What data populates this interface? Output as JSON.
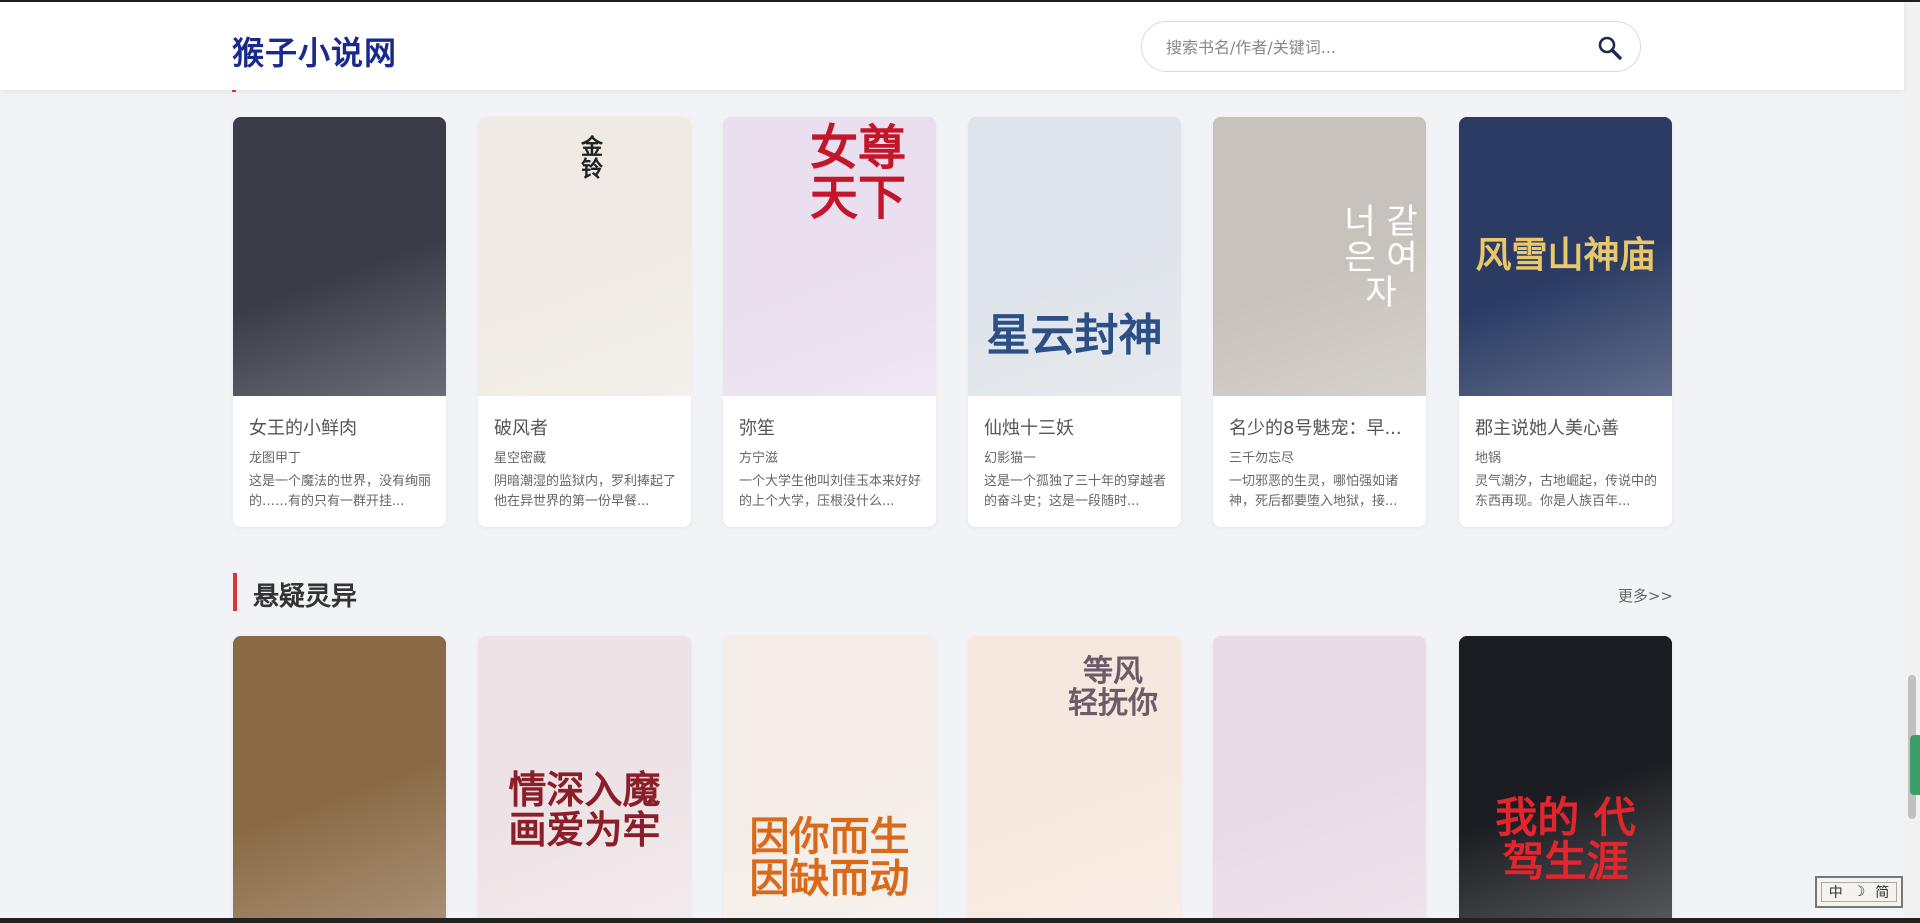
{
  "site": {
    "logo": "猴子小说网"
  },
  "search": {
    "placeholder": "搜索书名/作者/关键词..."
  },
  "section_top": {
    "books": [
      {
        "title": "女王的小鲜肉",
        "author": "龙图甲丁",
        "desc": "这是一个魔法的世界，没有绚丽的……有的只有一群开挂...",
        "cover_text": "",
        "cover_bg": "#3a3d48"
      },
      {
        "title": "破风者",
        "author": "星空密藏",
        "desc": "阴暗潮湿的监狱内，罗利捧起了他在异世界的第一份早餐...",
        "cover_text": "金铃",
        "cover_bg": "#efeae3"
      },
      {
        "title": "弥笙",
        "author": "方宁滋",
        "desc": "一个大学生他叫刘佳玉本来好好的上个大学，压根没什么...",
        "cover_text": "女尊天下",
        "cover_bg": "#e9dfee"
      },
      {
        "title": "仙烛十三妖",
        "author": "幻影猫一",
        "desc": "这是一个孤独了三十年的穿越者的奋斗史；这是一段随时...",
        "cover_text": "星云封神",
        "cover_bg": "#dfe4ea"
      },
      {
        "title": "名少的8号魅宠：早...",
        "author": "三千勿忘尽",
        "desc": "一切邪恶的生灵，哪怕强如诸神，死后都要堕入地狱，接...",
        "cover_text": "너 같은 여자",
        "cover_bg": "#c8c2bd"
      },
      {
        "title": "郡主说她人美心善",
        "author": "地锅",
        "desc": "灵气潮汐，古地崛起，传说中的东西再现。你是人族百年...",
        "cover_text": "风雪山神庙",
        "cover_bg": "#2b3b63"
      }
    ]
  },
  "section_suspense": {
    "title": "悬疑灵异",
    "more": "更多>>",
    "books": [
      {
        "cover_text": "",
        "cover_bg": "#8a6a45"
      },
      {
        "cover_text": "情深入魔 画爱为牢",
        "cover_bg": "#ede3e6"
      },
      {
        "cover_text": "因你而生 因缺而动",
        "cover_bg": "#f4ede7"
      },
      {
        "cover_text": "等风 轻抚你",
        "cover_bg": "#f6e8de"
      },
      {
        "cover_text": "",
        "cover_bg": "#e8dbe6"
      },
      {
        "cover_text": "我的 代驾生涯",
        "cover_bg": "#1c1d22"
      }
    ]
  },
  "stamp": {
    "chars": [
      "中",
      "☽",
      "简"
    ]
  },
  "colors": {
    "brand": "#1a2a8c",
    "accent_red": "#dd3333",
    "page_bg": "#f2f3f7"
  }
}
